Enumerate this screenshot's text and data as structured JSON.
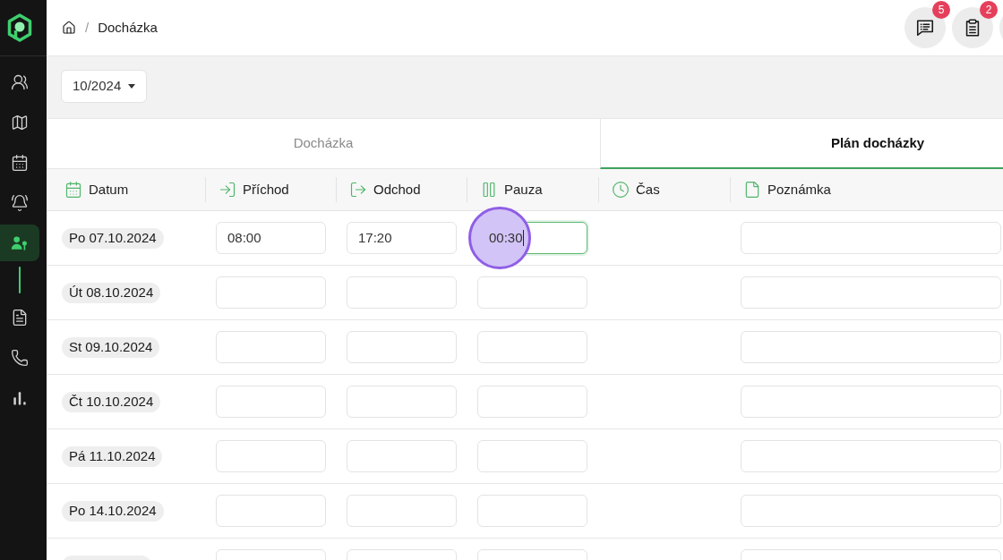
{
  "sidebar": {
    "items": [
      {
        "kind": "people",
        "selected": false,
        "expanded": false
      },
      {
        "kind": "map",
        "selected": false,
        "expanded": false
      },
      {
        "kind": "calendar",
        "selected": false,
        "expanded": false
      },
      {
        "kind": "alarm",
        "selected": false,
        "expanded": false
      },
      {
        "kind": "user-key",
        "selected": true,
        "expanded": true
      },
      {
        "kind": "document",
        "selected": false,
        "expanded": false
      },
      {
        "kind": "phone",
        "selected": false,
        "expanded": false
      },
      {
        "kind": "chart",
        "selected": false,
        "expanded": false
      }
    ]
  },
  "breadcrumb": {
    "separator": "/",
    "current": "Docházka"
  },
  "header_buttons": [
    {
      "kind": "messages",
      "badge": "5"
    },
    {
      "kind": "tasks",
      "badge": "2"
    },
    {
      "kind": "blank"
    }
  ],
  "month_select": {
    "value": "10/2024"
  },
  "tabs": [
    {
      "label": "Docházka",
      "selected": false
    },
    {
      "label": "Plán docházky",
      "selected": true
    }
  ],
  "columns": [
    {
      "kind": "date",
      "label": "Datum"
    },
    {
      "kind": "arrival",
      "label": "Příchod"
    },
    {
      "kind": "departure",
      "label": "Odchod"
    },
    {
      "kind": "pause",
      "label": "Pauza"
    },
    {
      "kind": "time",
      "label": "Čas"
    },
    {
      "kind": "note",
      "label": "Poznámka"
    }
  ],
  "click_indicator": {
    "visible": true
  },
  "rows": [
    {
      "date": "Po 07.10.2024",
      "fields": [
        {
          "value": "08:00",
          "focused": false
        },
        {
          "value": "17:20",
          "focused": false
        },
        {
          "value": "00:30",
          "focused": true
        }
      ],
      "note": {
        "focused": false
      }
    },
    {
      "date": "Út 08.10.2024",
      "fields": [
        {
          "focused": false
        },
        {
          "focused": false
        },
        {
          "focused": false
        }
      ],
      "note": {
        "focused": false
      }
    },
    {
      "date": "St 09.10.2024",
      "fields": [
        {
          "focused": false
        },
        {
          "focused": false
        },
        {
          "focused": false
        }
      ],
      "note": {
        "focused": false
      }
    },
    {
      "date": "Čt 10.10.2024",
      "fields": [
        {
          "focused": false
        },
        {
          "focused": false
        },
        {
          "focused": false
        }
      ],
      "note": {
        "focused": false
      }
    },
    {
      "date": "Pá 11.10.2024",
      "fields": [
        {
          "focused": false
        },
        {
          "focused": false
        },
        {
          "focused": false
        }
      ],
      "note": {
        "focused": false
      }
    },
    {
      "date": "Po 14.10.2024",
      "fields": [
        {
          "focused": false
        },
        {
          "focused": false
        },
        {
          "focused": false
        }
      ],
      "note": {
        "focused": false
      }
    },
    {
      "fields": [
        {
          "focused": false
        },
        {
          "focused": false
        },
        {
          "focused": false
        }
      ],
      "note": {
        "focused": false
      }
    }
  ]
}
